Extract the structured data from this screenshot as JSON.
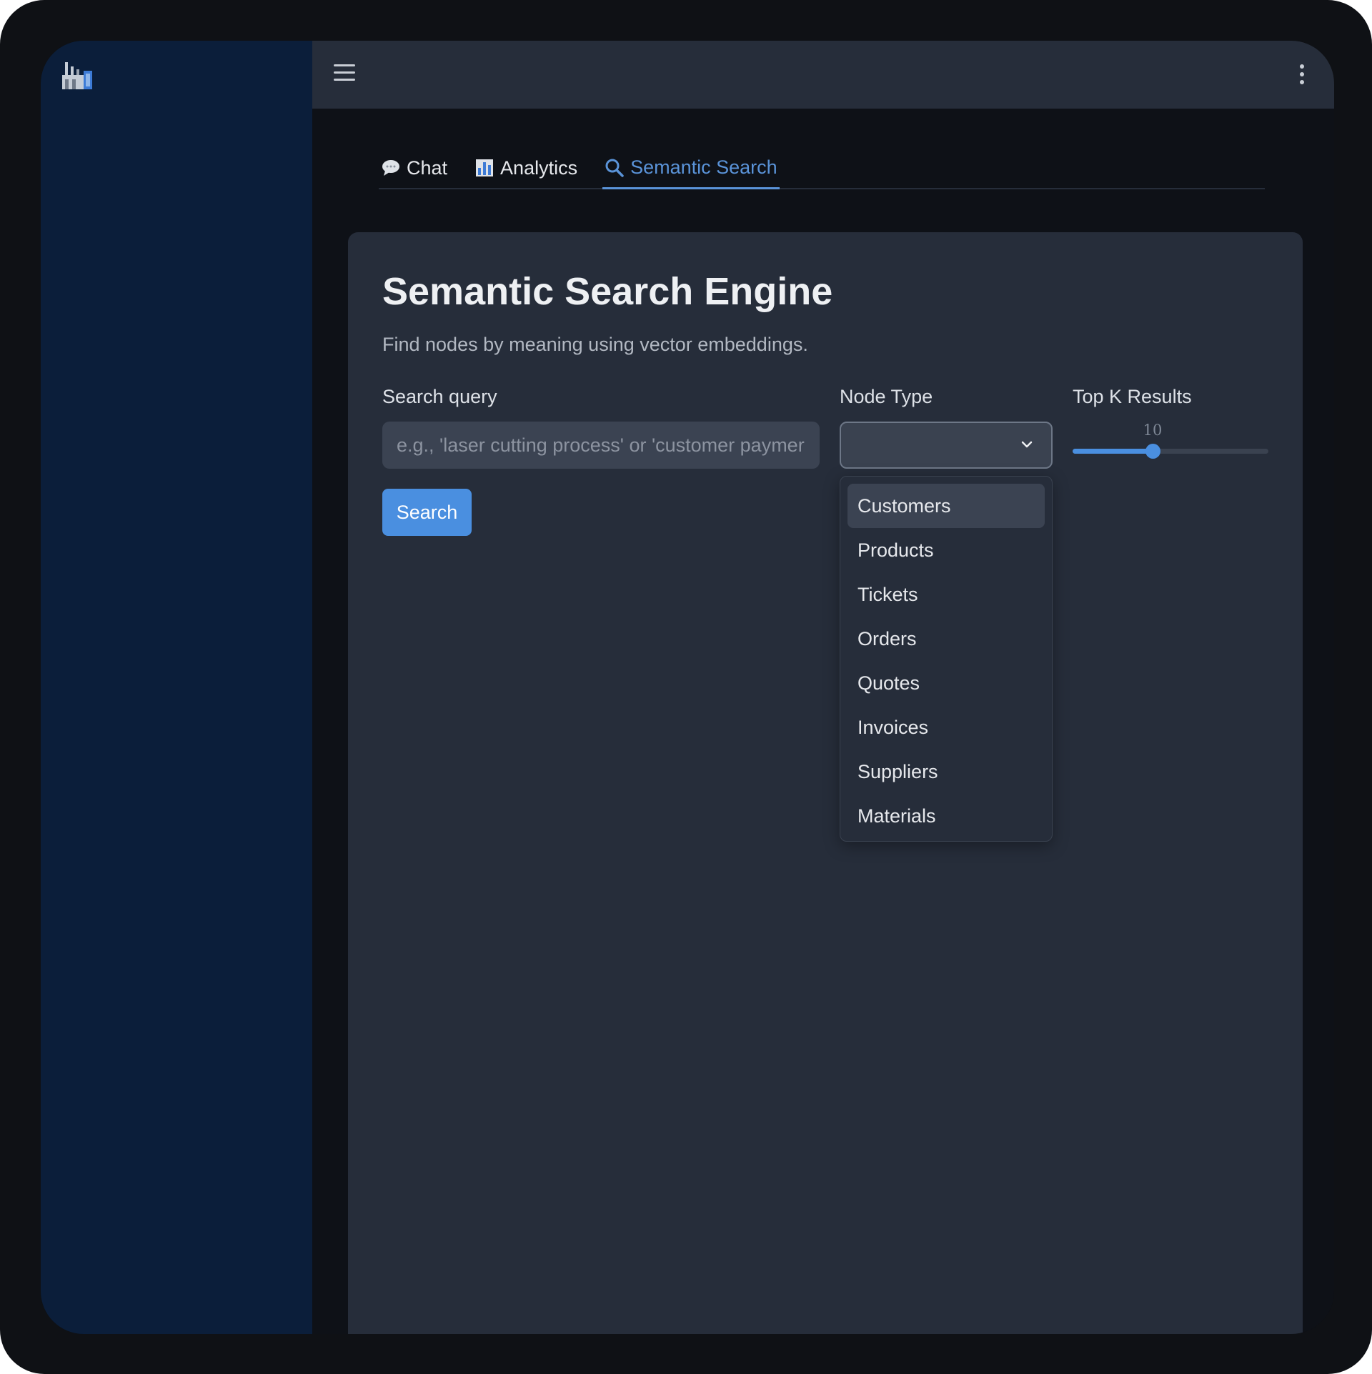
{
  "tabs": [
    {
      "label": "Chat",
      "icon": "speech-bubble-icon"
    },
    {
      "label": "Analytics",
      "icon": "bar-chart-icon"
    },
    {
      "label": "Semantic Search",
      "icon": "magnifier-icon"
    }
  ],
  "active_tab": "Semantic Search",
  "panel": {
    "title": "Semantic Search Engine",
    "subtitle": "Find nodes by meaning using vector embeddings."
  },
  "search": {
    "label": "Search query",
    "placeholder": "e.g., 'laser cutting process' or 'customer paymer",
    "value": "",
    "button_label": "Search"
  },
  "node_type": {
    "label": "Node Type",
    "selected": "",
    "options": [
      "Customers",
      "Products",
      "Tickets",
      "Orders",
      "Quotes",
      "Invoices",
      "Suppliers",
      "Materials"
    ],
    "highlighted": "Customers"
  },
  "top_k": {
    "label": "Top K Results",
    "value_text": "10",
    "value": 10,
    "min": 1,
    "max": 23
  },
  "colors": {
    "accent": "#4a8fe0",
    "sidebar": "#0b1e3a",
    "panel": "#262d3a",
    "background": "#0e1117"
  }
}
